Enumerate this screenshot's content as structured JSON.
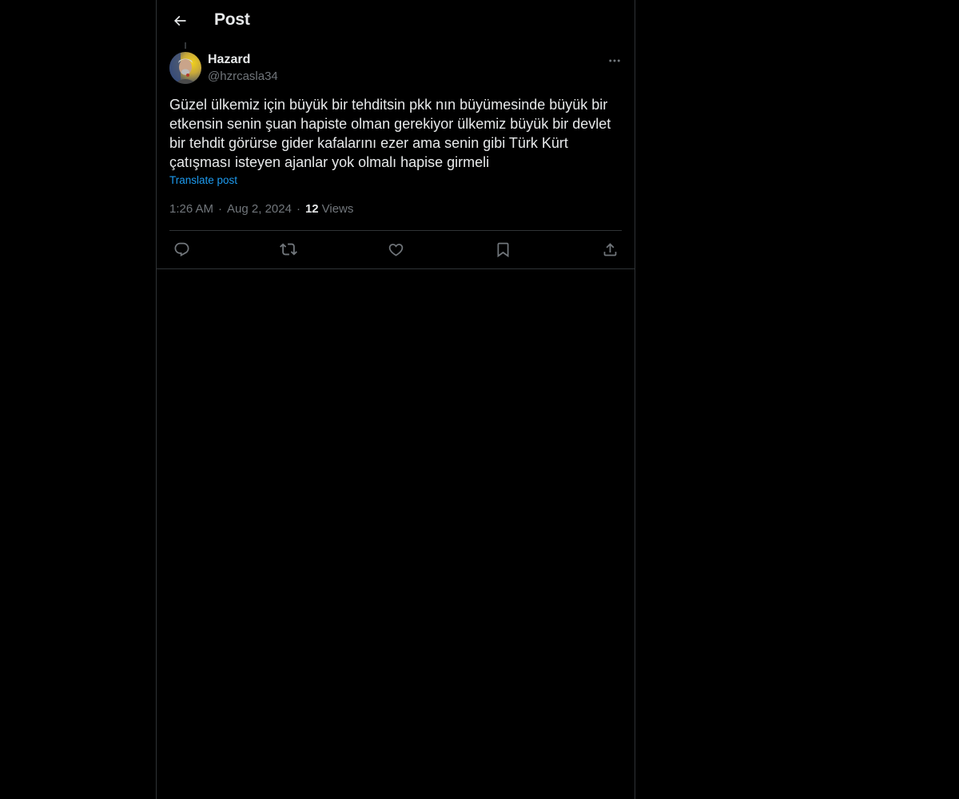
{
  "header": {
    "title": "Post",
    "back_icon": "arrow-left-icon"
  },
  "post": {
    "author": {
      "name": "Hazard",
      "handle": "@hzrcasla34",
      "avatar_icon": "avatar"
    },
    "text": "Güzel ülkemiz için büyük bir tehditsin pkk nın büyümesinde büyük bir etkensin senin şuan hapiste olman gerekiyor ülkemiz büyük bir devlet bir tehdit görürse gider kafalarını ezer ama senin gibi Türk Kürt çatışması isteyen ajanlar yok olmalı hapise girmeli",
    "translate_label": "Translate post",
    "time": "1:26 AM",
    "separator": "·",
    "date": "Aug 2, 2024",
    "views_count": "12",
    "views_label": "Views"
  },
  "actions": [
    {
      "name": "reply",
      "icon": "reply-icon"
    },
    {
      "name": "repost",
      "icon": "repost-icon"
    },
    {
      "name": "like",
      "icon": "heart-icon"
    },
    {
      "name": "bookmark",
      "icon": "bookmark-icon"
    },
    {
      "name": "share",
      "icon": "share-icon"
    }
  ],
  "colors": {
    "background": "#000000",
    "text": "#e7e9ea",
    "muted": "#71767b",
    "link": "#1d9bf0",
    "border": "#2f3336"
  }
}
